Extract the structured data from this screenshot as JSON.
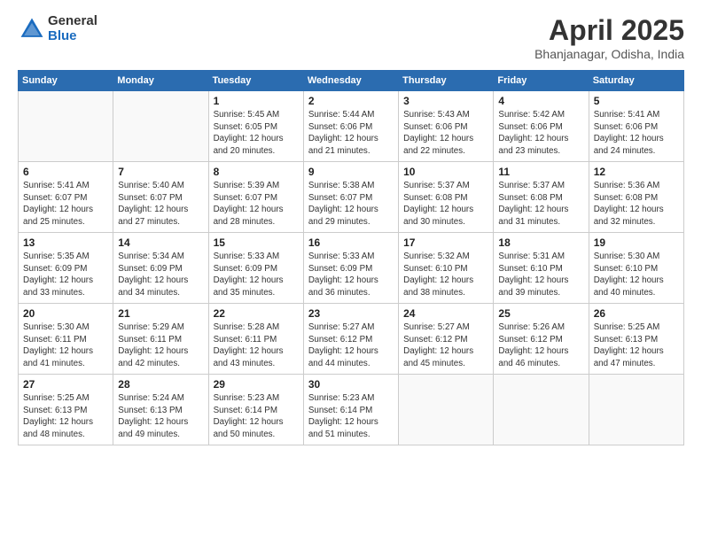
{
  "header": {
    "logo_general": "General",
    "logo_blue": "Blue",
    "month_title": "April 2025",
    "location": "Bhanjanagar, Odisha, India"
  },
  "calendar": {
    "days_of_week": [
      "Sunday",
      "Monday",
      "Tuesday",
      "Wednesday",
      "Thursday",
      "Friday",
      "Saturday"
    ],
    "weeks": [
      [
        {
          "day": "",
          "info": ""
        },
        {
          "day": "",
          "info": ""
        },
        {
          "day": "1",
          "info": "Sunrise: 5:45 AM\nSunset: 6:05 PM\nDaylight: 12 hours\nand 20 minutes."
        },
        {
          "day": "2",
          "info": "Sunrise: 5:44 AM\nSunset: 6:06 PM\nDaylight: 12 hours\nand 21 minutes."
        },
        {
          "day": "3",
          "info": "Sunrise: 5:43 AM\nSunset: 6:06 PM\nDaylight: 12 hours\nand 22 minutes."
        },
        {
          "day": "4",
          "info": "Sunrise: 5:42 AM\nSunset: 6:06 PM\nDaylight: 12 hours\nand 23 minutes."
        },
        {
          "day": "5",
          "info": "Sunrise: 5:41 AM\nSunset: 6:06 PM\nDaylight: 12 hours\nand 24 minutes."
        }
      ],
      [
        {
          "day": "6",
          "info": "Sunrise: 5:41 AM\nSunset: 6:07 PM\nDaylight: 12 hours\nand 25 minutes."
        },
        {
          "day": "7",
          "info": "Sunrise: 5:40 AM\nSunset: 6:07 PM\nDaylight: 12 hours\nand 27 minutes."
        },
        {
          "day": "8",
          "info": "Sunrise: 5:39 AM\nSunset: 6:07 PM\nDaylight: 12 hours\nand 28 minutes."
        },
        {
          "day": "9",
          "info": "Sunrise: 5:38 AM\nSunset: 6:07 PM\nDaylight: 12 hours\nand 29 minutes."
        },
        {
          "day": "10",
          "info": "Sunrise: 5:37 AM\nSunset: 6:08 PM\nDaylight: 12 hours\nand 30 minutes."
        },
        {
          "day": "11",
          "info": "Sunrise: 5:37 AM\nSunset: 6:08 PM\nDaylight: 12 hours\nand 31 minutes."
        },
        {
          "day": "12",
          "info": "Sunrise: 5:36 AM\nSunset: 6:08 PM\nDaylight: 12 hours\nand 32 minutes."
        }
      ],
      [
        {
          "day": "13",
          "info": "Sunrise: 5:35 AM\nSunset: 6:09 PM\nDaylight: 12 hours\nand 33 minutes."
        },
        {
          "day": "14",
          "info": "Sunrise: 5:34 AM\nSunset: 6:09 PM\nDaylight: 12 hours\nand 34 minutes."
        },
        {
          "day": "15",
          "info": "Sunrise: 5:33 AM\nSunset: 6:09 PM\nDaylight: 12 hours\nand 35 minutes."
        },
        {
          "day": "16",
          "info": "Sunrise: 5:33 AM\nSunset: 6:09 PM\nDaylight: 12 hours\nand 36 minutes."
        },
        {
          "day": "17",
          "info": "Sunrise: 5:32 AM\nSunset: 6:10 PM\nDaylight: 12 hours\nand 38 minutes."
        },
        {
          "day": "18",
          "info": "Sunrise: 5:31 AM\nSunset: 6:10 PM\nDaylight: 12 hours\nand 39 minutes."
        },
        {
          "day": "19",
          "info": "Sunrise: 5:30 AM\nSunset: 6:10 PM\nDaylight: 12 hours\nand 40 minutes."
        }
      ],
      [
        {
          "day": "20",
          "info": "Sunrise: 5:30 AM\nSunset: 6:11 PM\nDaylight: 12 hours\nand 41 minutes."
        },
        {
          "day": "21",
          "info": "Sunrise: 5:29 AM\nSunset: 6:11 PM\nDaylight: 12 hours\nand 42 minutes."
        },
        {
          "day": "22",
          "info": "Sunrise: 5:28 AM\nSunset: 6:11 PM\nDaylight: 12 hours\nand 43 minutes."
        },
        {
          "day": "23",
          "info": "Sunrise: 5:27 AM\nSunset: 6:12 PM\nDaylight: 12 hours\nand 44 minutes."
        },
        {
          "day": "24",
          "info": "Sunrise: 5:27 AM\nSunset: 6:12 PM\nDaylight: 12 hours\nand 45 minutes."
        },
        {
          "day": "25",
          "info": "Sunrise: 5:26 AM\nSunset: 6:12 PM\nDaylight: 12 hours\nand 46 minutes."
        },
        {
          "day": "26",
          "info": "Sunrise: 5:25 AM\nSunset: 6:13 PM\nDaylight: 12 hours\nand 47 minutes."
        }
      ],
      [
        {
          "day": "27",
          "info": "Sunrise: 5:25 AM\nSunset: 6:13 PM\nDaylight: 12 hours\nand 48 minutes."
        },
        {
          "day": "28",
          "info": "Sunrise: 5:24 AM\nSunset: 6:13 PM\nDaylight: 12 hours\nand 49 minutes."
        },
        {
          "day": "29",
          "info": "Sunrise: 5:23 AM\nSunset: 6:14 PM\nDaylight: 12 hours\nand 50 minutes."
        },
        {
          "day": "30",
          "info": "Sunrise: 5:23 AM\nSunset: 6:14 PM\nDaylight: 12 hours\nand 51 minutes."
        },
        {
          "day": "",
          "info": ""
        },
        {
          "day": "",
          "info": ""
        },
        {
          "day": "",
          "info": ""
        }
      ]
    ]
  }
}
